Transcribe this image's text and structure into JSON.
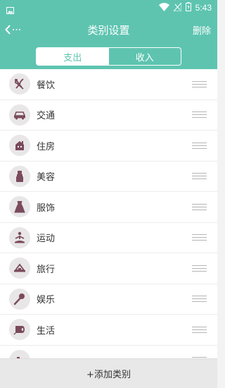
{
  "status_bar": {
    "time": "5:43",
    "left_icon": "image-icon",
    "icons": [
      "wifi-icon",
      "signal-icon",
      "battery-icon"
    ]
  },
  "header": {
    "back_icon": "back-icon",
    "title": "类别设置",
    "action_label": "删除"
  },
  "tabs": [
    {
      "label": "支出",
      "active": true
    },
    {
      "label": "收入",
      "active": false
    }
  ],
  "categories": [
    {
      "label": "餐饮",
      "icon": "fork-knife-icon"
    },
    {
      "label": "交通",
      "icon": "car-icon"
    },
    {
      "label": "住房",
      "icon": "house-icon"
    },
    {
      "label": "美容",
      "icon": "cosmetics-icon"
    },
    {
      "label": "服饰",
      "icon": "dress-icon"
    },
    {
      "label": "运动",
      "icon": "yoga-icon"
    },
    {
      "label": "旅行",
      "icon": "travel-icon"
    },
    {
      "label": "娱乐",
      "icon": "microphone-icon"
    },
    {
      "label": "生活",
      "icon": "tissue-roll-icon"
    },
    {
      "label": "",
      "icon": "other-icon"
    }
  ],
  "footer": {
    "add_label": "+添加类别"
  },
  "colors": {
    "accent": "#5ec4b0",
    "icon_glyph": "#7a4a5c",
    "icon_bg": "#e8e6e7"
  }
}
